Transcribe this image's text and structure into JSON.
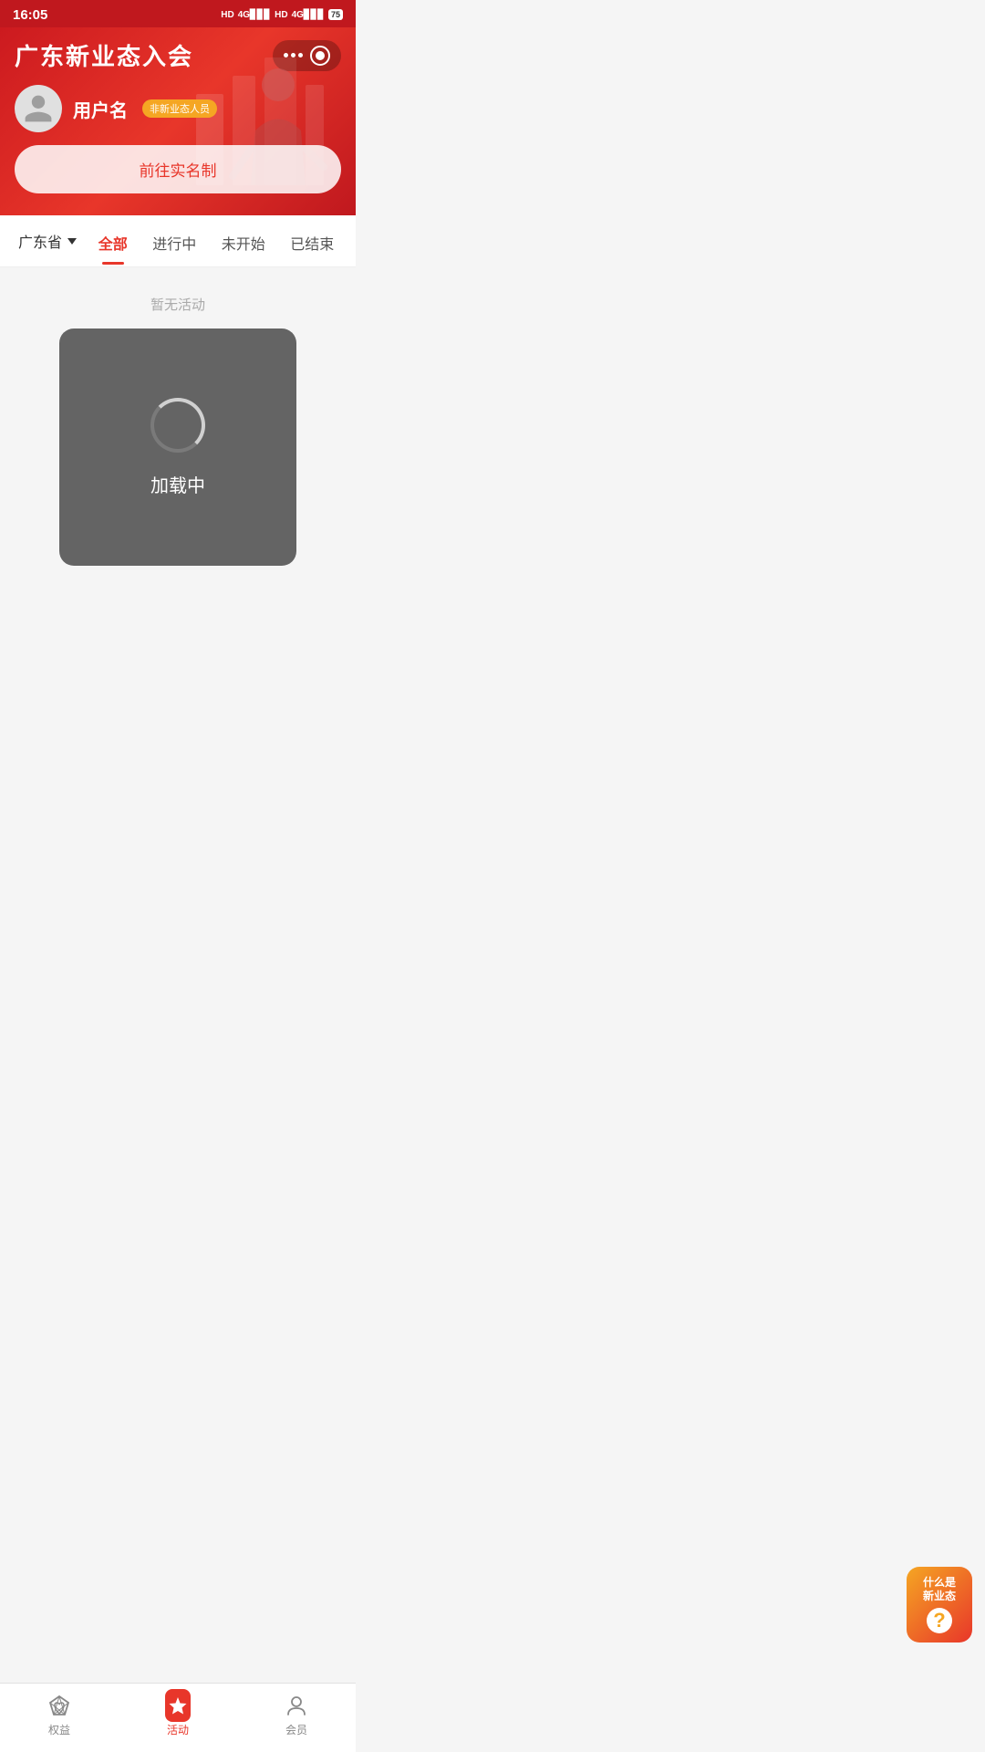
{
  "statusBar": {
    "time": "16:05",
    "batteryLevel": "75"
  },
  "header": {
    "title": "广东新业态入会",
    "menuLabel": "菜单",
    "recordLabel": "录制"
  },
  "user": {
    "name": "用户名",
    "badge": "非新业态人员",
    "avatarAlt": "用户头像"
  },
  "realnameButton": {
    "label": "前往实名制"
  },
  "regionSelector": {
    "region": "广东省",
    "label": "地区选择"
  },
  "filterTabs": [
    {
      "label": "全部",
      "active": true
    },
    {
      "label": "进行中",
      "active": false
    },
    {
      "label": "未开始",
      "active": false
    },
    {
      "label": "已结束",
      "active": false
    }
  ],
  "content": {
    "emptyText": "暂无活动",
    "loadingText": "加载中"
  },
  "floatingButton": {
    "line1": "什么是",
    "line2": "新业态",
    "icon": "?"
  },
  "bottomNav": [
    {
      "label": "权益",
      "active": false,
      "iconType": "diamond"
    },
    {
      "label": "活动",
      "active": true,
      "iconType": "star"
    },
    {
      "label": "会员",
      "active": false,
      "iconType": "person"
    }
  ]
}
